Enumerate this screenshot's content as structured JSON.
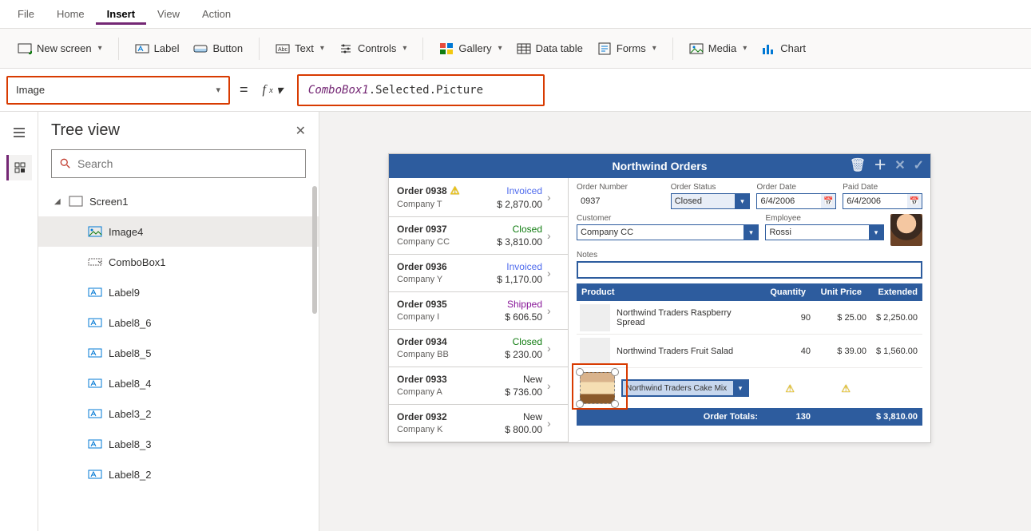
{
  "menubar": {
    "items": [
      "File",
      "Home",
      "Insert",
      "View",
      "Action"
    ],
    "active": 2
  },
  "ribbon": {
    "newscreen": "New screen",
    "label": "Label",
    "button": "Button",
    "text": "Text",
    "controls": "Controls",
    "gallery": "Gallery",
    "datatable": "Data table",
    "forms": "Forms",
    "media": "Media",
    "chart": "Chart"
  },
  "formula": {
    "property": "Image",
    "obj": "ComboBox1",
    "rest": ".Selected.Picture"
  },
  "tree": {
    "title": "Tree view",
    "search_placeholder": "Search",
    "items": [
      {
        "name": "Screen1",
        "depth": 0,
        "icon": "screen",
        "expanded": true
      },
      {
        "name": "Image4",
        "depth": 1,
        "icon": "image",
        "selected": true
      },
      {
        "name": "ComboBox1",
        "depth": 1,
        "icon": "combobox"
      },
      {
        "name": "Label9",
        "depth": 1,
        "icon": "label"
      },
      {
        "name": "Label8_6",
        "depth": 1,
        "icon": "label"
      },
      {
        "name": "Label8_5",
        "depth": 1,
        "icon": "label"
      },
      {
        "name": "Label8_4",
        "depth": 1,
        "icon": "label"
      },
      {
        "name": "Label3_2",
        "depth": 1,
        "icon": "label"
      },
      {
        "name": "Label8_3",
        "depth": 1,
        "icon": "label"
      },
      {
        "name": "Label8_2",
        "depth": 1,
        "icon": "label"
      }
    ]
  },
  "app": {
    "title": "Northwind Orders",
    "orders": [
      {
        "no": "Order 0938",
        "warn": true,
        "company": "Company T",
        "status": "Invoiced",
        "status_class": "stat-invoiced",
        "amount": "$ 2,870.00"
      },
      {
        "no": "Order 0937",
        "warn": false,
        "company": "Company CC",
        "status": "Closed",
        "status_class": "stat-closed",
        "amount": "$ 3,810.00"
      },
      {
        "no": "Order 0936",
        "warn": false,
        "company": "Company Y",
        "status": "Invoiced",
        "status_class": "stat-invoiced",
        "amount": "$ 1,170.00"
      },
      {
        "no": "Order 0935",
        "warn": false,
        "company": "Company I",
        "status": "Shipped",
        "status_class": "stat-shipped",
        "amount": "$ 606.50"
      },
      {
        "no": "Order 0934",
        "warn": false,
        "company": "Company BB",
        "status": "Closed",
        "status_class": "stat-closed",
        "amount": "$ 230.00"
      },
      {
        "no": "Order 0933",
        "warn": false,
        "company": "Company A",
        "status": "New",
        "status_class": "stat-new",
        "amount": "$ 736.00"
      },
      {
        "no": "Order 0932",
        "warn": false,
        "company": "Company K",
        "status": "New",
        "status_class": "stat-new",
        "amount": "$ 800.00"
      }
    ],
    "detail": {
      "fields": {
        "order_number_label": "Order Number",
        "order_number": "0937",
        "order_status_label": "Order Status",
        "order_status": "Closed",
        "order_date_label": "Order Date",
        "order_date": "6/4/2006",
        "paid_date_label": "Paid Date",
        "paid_date": "6/4/2006",
        "customer_label": "Customer",
        "customer": "Company CC",
        "employee_label": "Employee",
        "employee": "Rossi",
        "notes_label": "Notes"
      },
      "product_header": {
        "product": "Product",
        "qty": "Quantity",
        "price": "Unit Price",
        "ext": "Extended"
      },
      "products": [
        {
          "img": "food1",
          "name": "Northwind Traders Raspberry Spread",
          "qty": "90",
          "price": "$ 25.00",
          "ext": "$ 2,250.00"
        },
        {
          "img": "food2",
          "name": "Northwind Traders Fruit Salad",
          "qty": "40",
          "price": "$ 39.00",
          "ext": "$ 1,560.00"
        }
      ],
      "new_product": "Northwind Traders Cake Mix",
      "totals": {
        "label": "Order Totals:",
        "qty": "130",
        "ext": "$ 3,810.00"
      }
    }
  }
}
